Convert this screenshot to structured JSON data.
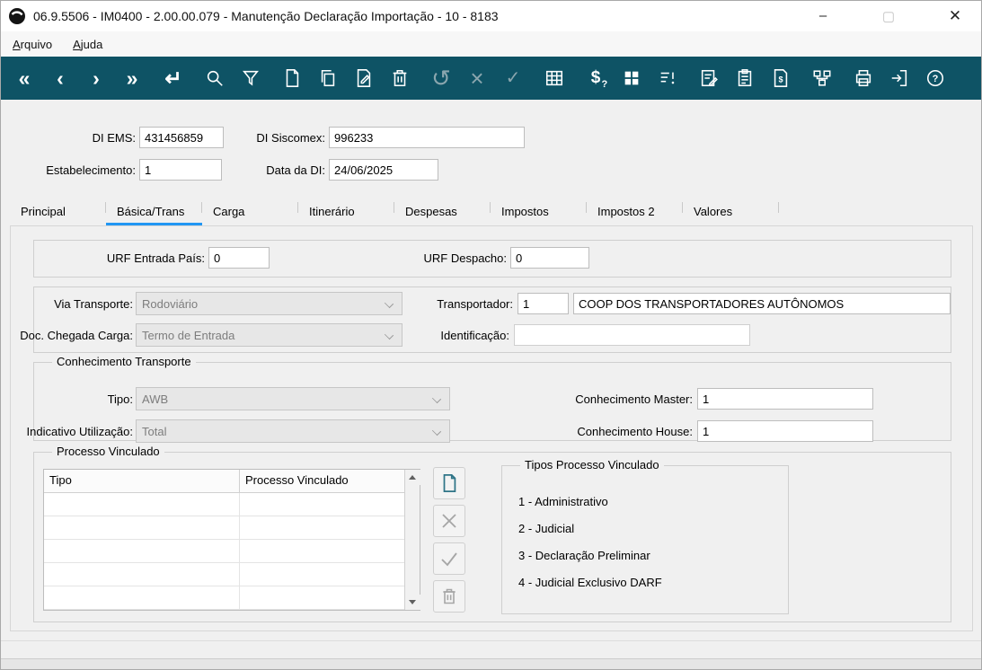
{
  "window": {
    "title": "06.9.5506 - IM0400 - 2.00.00.079 - Manutenção Declaração Importação - 10 - 8183",
    "controls": {
      "minimize": "–",
      "maximize": "▢",
      "close": "✕"
    }
  },
  "menubar": {
    "items": [
      {
        "label": "Arquivo"
      },
      {
        "label": "Ajuda"
      }
    ]
  },
  "toolbar": {
    "bg_color": "#0e5365",
    "glyphs": {
      "first": "«",
      "prev": "‹",
      "next": "›",
      "last": "»",
      "return": "↵",
      "undo": "↺",
      "cancel": "×",
      "confirm": "✓",
      "currency": "$",
      "currency_q": "?"
    },
    "icon_names": [
      "first-record-icon",
      "prev-record-icon",
      "next-record-icon",
      "last-record-icon",
      "return-icon",
      "search-icon",
      "filter-icon",
      "add-record-icon",
      "copy-record-icon",
      "edit-record-icon",
      "delete-record-icon",
      "undo-icon",
      "cancel-icon",
      "confirm-icon",
      "table-icon",
      "currency-query-icon",
      "layout-icon",
      "sort-exclamation-icon",
      "notes-icon",
      "clipboard-icon",
      "invoice-icon",
      "hierarchy-icon",
      "print-icon",
      "exit-icon",
      "help-icon"
    ]
  },
  "header_fields": {
    "di_ems": {
      "label": "DI EMS:",
      "value": "431456859"
    },
    "di_siscomex": {
      "label": "DI Siscomex:",
      "value": "996233"
    },
    "estabelecimento": {
      "label": "Estabelecimento:",
      "value": "1"
    },
    "data_di": {
      "label": "Data da DI:",
      "value": "24/06/2025"
    }
  },
  "tabs": [
    {
      "label": "Principal",
      "active": false
    },
    {
      "label": "Básica/Trans",
      "active": true
    },
    {
      "label": "Carga",
      "active": false
    },
    {
      "label": "Itinerário",
      "active": false
    },
    {
      "label": "Despesas",
      "active": false
    },
    {
      "label": "Impostos",
      "active": false
    },
    {
      "label": "Impostos 2",
      "active": false
    },
    {
      "label": "Valores",
      "active": false
    }
  ],
  "urf_group": {
    "entrada_pais_label": "URF Entrada País:",
    "entrada_pais_value": "0",
    "despacho_label": "URF Despacho:",
    "despacho_value": "0"
  },
  "transporte_group": {
    "via_transporte_label": "Via Transporte:",
    "via_transporte_value": "Rodoviário",
    "transportador_label": "Transportador:",
    "transportador_codigo": "1",
    "transportador_nome": "COOP DOS TRANSPORTADORES AUTÔNOMOS",
    "doc_chegada_label": "Doc. Chegada Carga:",
    "doc_chegada_value": "Termo de Entrada",
    "identificacao_label": "Identificação:",
    "identificacao_value": ""
  },
  "conhecimento_group": {
    "title": "Conhecimento Transporte",
    "tipo_label": "Tipo:",
    "tipo_value": "AWB",
    "master_label": "Conhecimento Master:",
    "master_value": "1",
    "indicativo_label": "Indicativo Utilização:",
    "indicativo_value": "Total",
    "house_label": "Conhecimento House:",
    "house_value": "1"
  },
  "processo_group": {
    "title": "Processo Vinculado",
    "columns": [
      "Tipo",
      "Processo Vinculado"
    ],
    "rows": [],
    "tipos": {
      "title": "Tipos Processo Vinculado",
      "items": [
        "1 - Administrativo",
        "2 - Judicial",
        "3 - Declaração Preliminar",
        "4 - Judicial Exclusivo DARF"
      ]
    }
  }
}
